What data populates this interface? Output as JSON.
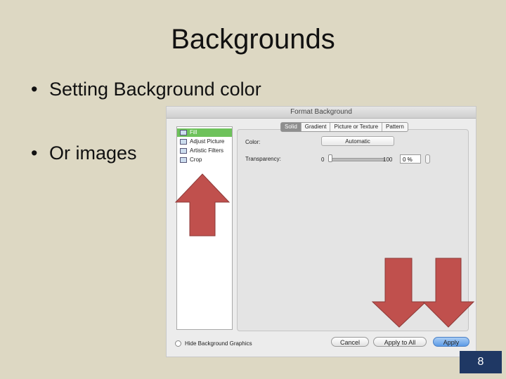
{
  "slide": {
    "title": "Backgrounds",
    "bullets": [
      "Setting Background color",
      "Or images"
    ],
    "bullet_marker": "•",
    "page_number": "8"
  },
  "dialog": {
    "title": "Format Background",
    "sidebar": {
      "items": [
        {
          "label": "Fill",
          "icon": "fill-icon"
        },
        {
          "label": "Adjust Picture",
          "icon": "adjust-picture-icon"
        },
        {
          "label": "Artistic Filters",
          "icon": "artistic-filters-icon"
        },
        {
          "label": "Crop",
          "icon": "crop-icon"
        }
      ],
      "selected": "Fill"
    },
    "tabs": [
      {
        "label": "Solid",
        "active": true
      },
      {
        "label": "Gradient",
        "active": false
      },
      {
        "label": "Picture or Texture",
        "active": false
      },
      {
        "label": "Pattern",
        "active": false
      }
    ],
    "color_label": "Color:",
    "color_value": "Automatic",
    "transparency_label": "Transparency:",
    "slider_min": "0",
    "slider_max": "100",
    "transparency_value": "0 %",
    "hide_graphics_label": "Hide Background Graphics",
    "buttons": {
      "cancel": "Cancel",
      "apply_all": "Apply to All",
      "apply": "Apply"
    }
  },
  "colors": {
    "slide_bg": "#ddd8c3",
    "arrow": "#c0504d",
    "selection": "#6ec25b",
    "page_badge": "#1f3864",
    "apply_button": "#5d9be6"
  },
  "annotations": {
    "arrows": [
      "up-arrow",
      "down-arrow",
      "down-arrow"
    ]
  }
}
